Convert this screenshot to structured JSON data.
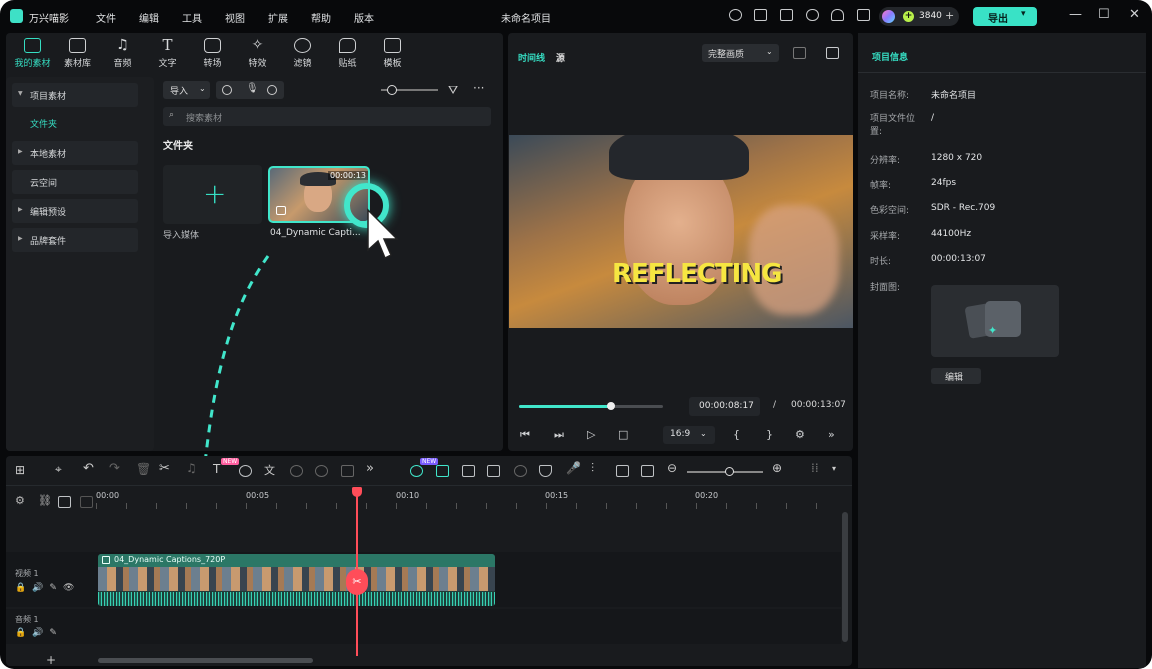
{
  "app": {
    "name": "万兴喵影",
    "project_title": "未命名项目",
    "credits": "3840",
    "export_label": "导出"
  },
  "menu": [
    "文件",
    "编辑",
    "工具",
    "视图",
    "扩展",
    "帮助",
    "版本"
  ],
  "tools": [
    {
      "label": "我的素材"
    },
    {
      "label": "素材库"
    },
    {
      "label": "音频"
    },
    {
      "label": "文字"
    },
    {
      "label": "转场"
    },
    {
      "label": "特效"
    },
    {
      "label": "滤镜"
    },
    {
      "label": "贴纸"
    },
    {
      "label": "模板"
    }
  ],
  "sidebar": {
    "items": [
      "项目素材",
      "文件夹",
      "本地素材",
      "云空间",
      "编辑预设",
      "品牌套件"
    ]
  },
  "media": {
    "import_label": "导入",
    "search_placeholder": "搜索素材",
    "folder_title": "文件夹",
    "import_media_label": "导入媒体",
    "clip_name": "04_Dynamic Capti...",
    "clip_duration": "00:00:13"
  },
  "preview": {
    "tab_timeline": "时间线",
    "tab_source": "源",
    "quality": "完整画质",
    "caption": "REFLECTING",
    "current_time": "00:00:08:17",
    "separator": "/",
    "total_time": "00:00:13:07",
    "ratio": "16:9",
    "progress": 0.64
  },
  "info": {
    "title": "项目信息",
    "rows": [
      {
        "label": "项目名称:",
        "value": "未命名项目"
      },
      {
        "label": "项目文件位置:",
        "value": "/"
      },
      {
        "label": "分辨率:",
        "value": "1280 x 720"
      },
      {
        "label": "帧率:",
        "value": "24fps"
      },
      {
        "label": "色彩空间:",
        "value": "SDR - Rec.709"
      },
      {
        "label": "采样率:",
        "value": "44100Hz"
      },
      {
        "label": "时长:",
        "value": "00:00:13:07"
      },
      {
        "label": "封面图:",
        "value": ""
      }
    ],
    "edit_label": "编辑"
  },
  "timeline": {
    "ruler": [
      "00:00",
      "00:05",
      "00:10",
      "00:15",
      "00:20"
    ],
    "video_track": "视频 1",
    "audio_track": "音频 1",
    "clip_title": "04_Dynamic Captions_720P",
    "badge_new": "NEW"
  },
  "colors": {
    "accent": "#3ee0c6",
    "playhead": "#ff4d59"
  }
}
